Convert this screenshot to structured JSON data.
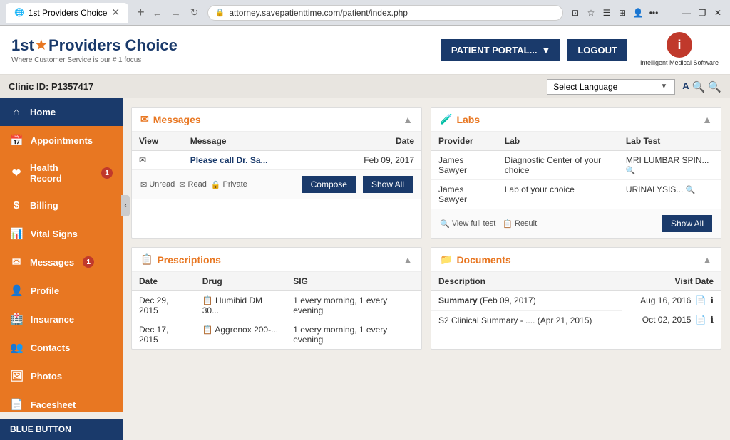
{
  "browser": {
    "tab_title": "1st Providers Choice",
    "url": "attorney.savepatienttime.com/patient/index.php"
  },
  "header": {
    "logo_name": "1st",
    "logo_star": "★",
    "logo_rest": "Providers Choice",
    "logo_sub": "Where Customer Service is our # 1 focus",
    "patient_portal_label": "PATIENT PORTAL...",
    "logout_label": "LOGOUT",
    "ims_label": "Intelligent Medical Software"
  },
  "clinic_bar": {
    "clinic_id": "Clinic ID: P1357417",
    "select_language": "Select Language",
    "font_icon": "A",
    "search_icon1": "🔍",
    "search_icon2": "🔍"
  },
  "sidebar": {
    "items": [
      {
        "id": "home",
        "label": "Home",
        "icon": "⌂",
        "active": true,
        "badge": null
      },
      {
        "id": "appointments",
        "label": "Appointments",
        "icon": "📅",
        "active": false,
        "badge": null
      },
      {
        "id": "health-record",
        "label": "Health Record",
        "icon": "❤",
        "active": false,
        "badge": "1"
      },
      {
        "id": "billing",
        "label": "Billing",
        "icon": "$",
        "active": false,
        "badge": null
      },
      {
        "id": "vital-signs",
        "label": "Vital Signs",
        "icon": "📊",
        "active": false,
        "badge": null
      },
      {
        "id": "messages",
        "label": "Messages",
        "icon": "✉",
        "active": false,
        "badge": "1"
      },
      {
        "id": "profile",
        "label": "Profile",
        "icon": "👤",
        "active": false,
        "badge": null
      },
      {
        "id": "insurance",
        "label": "Insurance",
        "icon": "🏥",
        "active": false,
        "badge": null
      },
      {
        "id": "contacts",
        "label": "Contacts",
        "icon": "👥",
        "active": false,
        "badge": null
      },
      {
        "id": "photos",
        "label": "Photos",
        "icon": "🖼",
        "active": false,
        "badge": null
      },
      {
        "id": "facesheet",
        "label": "Facesheet",
        "icon": "📄",
        "active": false,
        "badge": null
      }
    ],
    "blue_button": "BLUE BUTTON"
  },
  "messages_card": {
    "title": "Messages",
    "title_icon": "✉",
    "columns": [
      "View",
      "Message",
      "Date"
    ],
    "rows": [
      {
        "view_icon": "✉",
        "message": "Please call Dr. Sa...",
        "date": "Feb 09, 2017"
      }
    ],
    "footer": {
      "unread": "Unread",
      "read": "Read",
      "private": "Private",
      "compose_label": "Compose",
      "show_all_label": "Show All"
    }
  },
  "labs_card": {
    "title": "Labs",
    "title_icon": "🧪",
    "columns": [
      "Provider",
      "Lab",
      "Lab Test"
    ],
    "rows": [
      {
        "provider": "James Sawyer",
        "lab": "Diagnostic Center of your choice",
        "lab_test": "MRI LUMBAR SPIN..."
      },
      {
        "provider": "James Sawyer",
        "lab": "Lab of your choice",
        "lab_test": "URINALYSIS..."
      }
    ],
    "footer": {
      "view_full_test": "View full test",
      "result": "Result",
      "show_all_label": "Show All"
    }
  },
  "prescriptions_card": {
    "title": "Prescriptions",
    "title_icon": "📋",
    "columns": [
      "Date",
      "Drug",
      "SIG"
    ],
    "rows": [
      {
        "date": "Dec 29, 2015",
        "drug": "Humibid DM 30...",
        "sig": "1 every morning, 1 every evening"
      },
      {
        "date": "Dec 17, 2015",
        "drug": "Aggrenox 200-...",
        "sig": "1 every morning, 1 every evening"
      }
    ]
  },
  "documents_card": {
    "title": "Documents",
    "title_icon": "📁",
    "columns": [
      "Description",
      "Visit Date"
    ],
    "rows": [
      {
        "description": "Summary (Feb 09, 2017)",
        "visit_date": "Aug 16, 2016"
      },
      {
        "description": "S2 Clinical Summary - .... (Apr 21, 2015)",
        "visit_date": "Oct 02, 2015"
      }
    ]
  }
}
